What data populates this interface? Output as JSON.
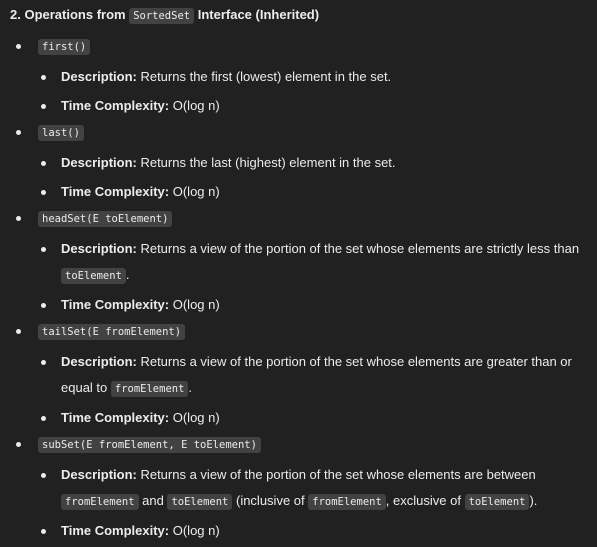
{
  "heading": {
    "prefix": "2. Operations from ",
    "code": "SortedSet",
    "suffix": " Interface (Inherited)"
  },
  "labels": {
    "description": "Description:",
    "time_complexity": "Time Complexity:"
  },
  "methods": [
    {
      "signature": "first()",
      "description": [
        " Returns the first (lowest) element in the set."
      ],
      "complexity": " O(log n)"
    },
    {
      "signature": "last()",
      "description": [
        " Returns the last (highest) element in the set."
      ],
      "complexity": " O(log n)"
    },
    {
      "signature": "headSet(E toElement)",
      "description": [
        " Returns a view of the portion of the set whose elements are strictly less than ",
        "toElement",
        "."
      ],
      "complexity": " O(log n)"
    },
    {
      "signature": "tailSet(E fromElement)",
      "description": [
        " Returns a view of the portion of the set whose elements are greater than or equal to ",
        "fromElement",
        "."
      ],
      "complexity": " O(log n)"
    },
    {
      "signature": "subSet(E fromElement, E toElement)",
      "description": [
        " Returns a view of the portion of the set whose elements are between ",
        "fromElement",
        " and ",
        "toElement",
        " (inclusive of ",
        "fromElement",
        ", exclusive of ",
        "toElement",
        ")."
      ],
      "complexity": " O(log n)"
    }
  ]
}
